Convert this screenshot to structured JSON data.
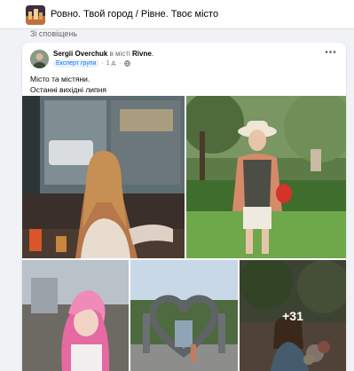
{
  "group": {
    "title": "Ровно. Твой город / Рівне. Твоє місто"
  },
  "notifications_link": "Зі сповіщень",
  "post": {
    "author": "Sergii Overchuk",
    "in_text": " в місті ",
    "city": "Rivne",
    "city_suffix": ".",
    "badge": "Експерт групи",
    "separator": "·",
    "time": "1 д.",
    "time_separator": "·",
    "more_label": "•••",
    "text_lines": [
      "Місто та містяни.",
      "Останні вихідні липня"
    ],
    "more_photos_count": "+31"
  },
  "icons": {
    "globe": "globe-icon",
    "more": "more-horizontal-icon"
  },
  "colors": {
    "link_blue": "#1b74e4",
    "secondary_text": "#65676b",
    "background": "#f0f2f5"
  }
}
